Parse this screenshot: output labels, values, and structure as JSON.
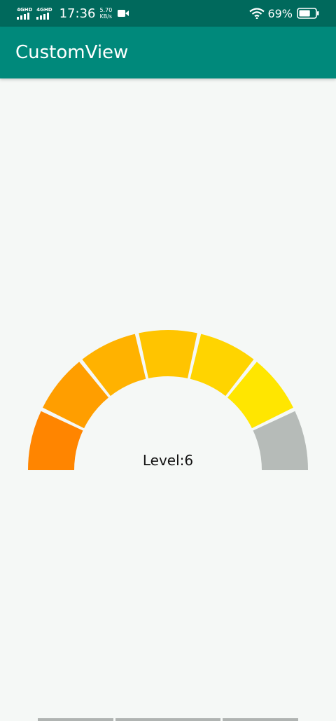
{
  "status_bar": {
    "sim1_label": "4GHD",
    "sim2_label": "4GHD",
    "time": "17:36",
    "speed_value": "5.70",
    "speed_unit": "KB/s",
    "battery_percent": "69%",
    "battery_level": 0.69,
    "icons": [
      "signal-icon",
      "signal-icon",
      "video-icon",
      "wifi-icon",
      "battery-icon"
    ]
  },
  "app_bar": {
    "title": "CustomView"
  },
  "gauge": {
    "label_prefix": "Level:",
    "level": 6,
    "label": "Level:6",
    "segment_count": 7,
    "segment_colors": [
      "#ff8500",
      "#ff9e00",
      "#ffb200",
      "#ffc400",
      "#ffd400",
      "#ffe600",
      "#b6bbb8"
    ],
    "inactive_color": "#b6bbb8"
  },
  "colors": {
    "status_bar": "#00695c",
    "app_bar": "#00897b",
    "background": "#f5f8f6"
  }
}
